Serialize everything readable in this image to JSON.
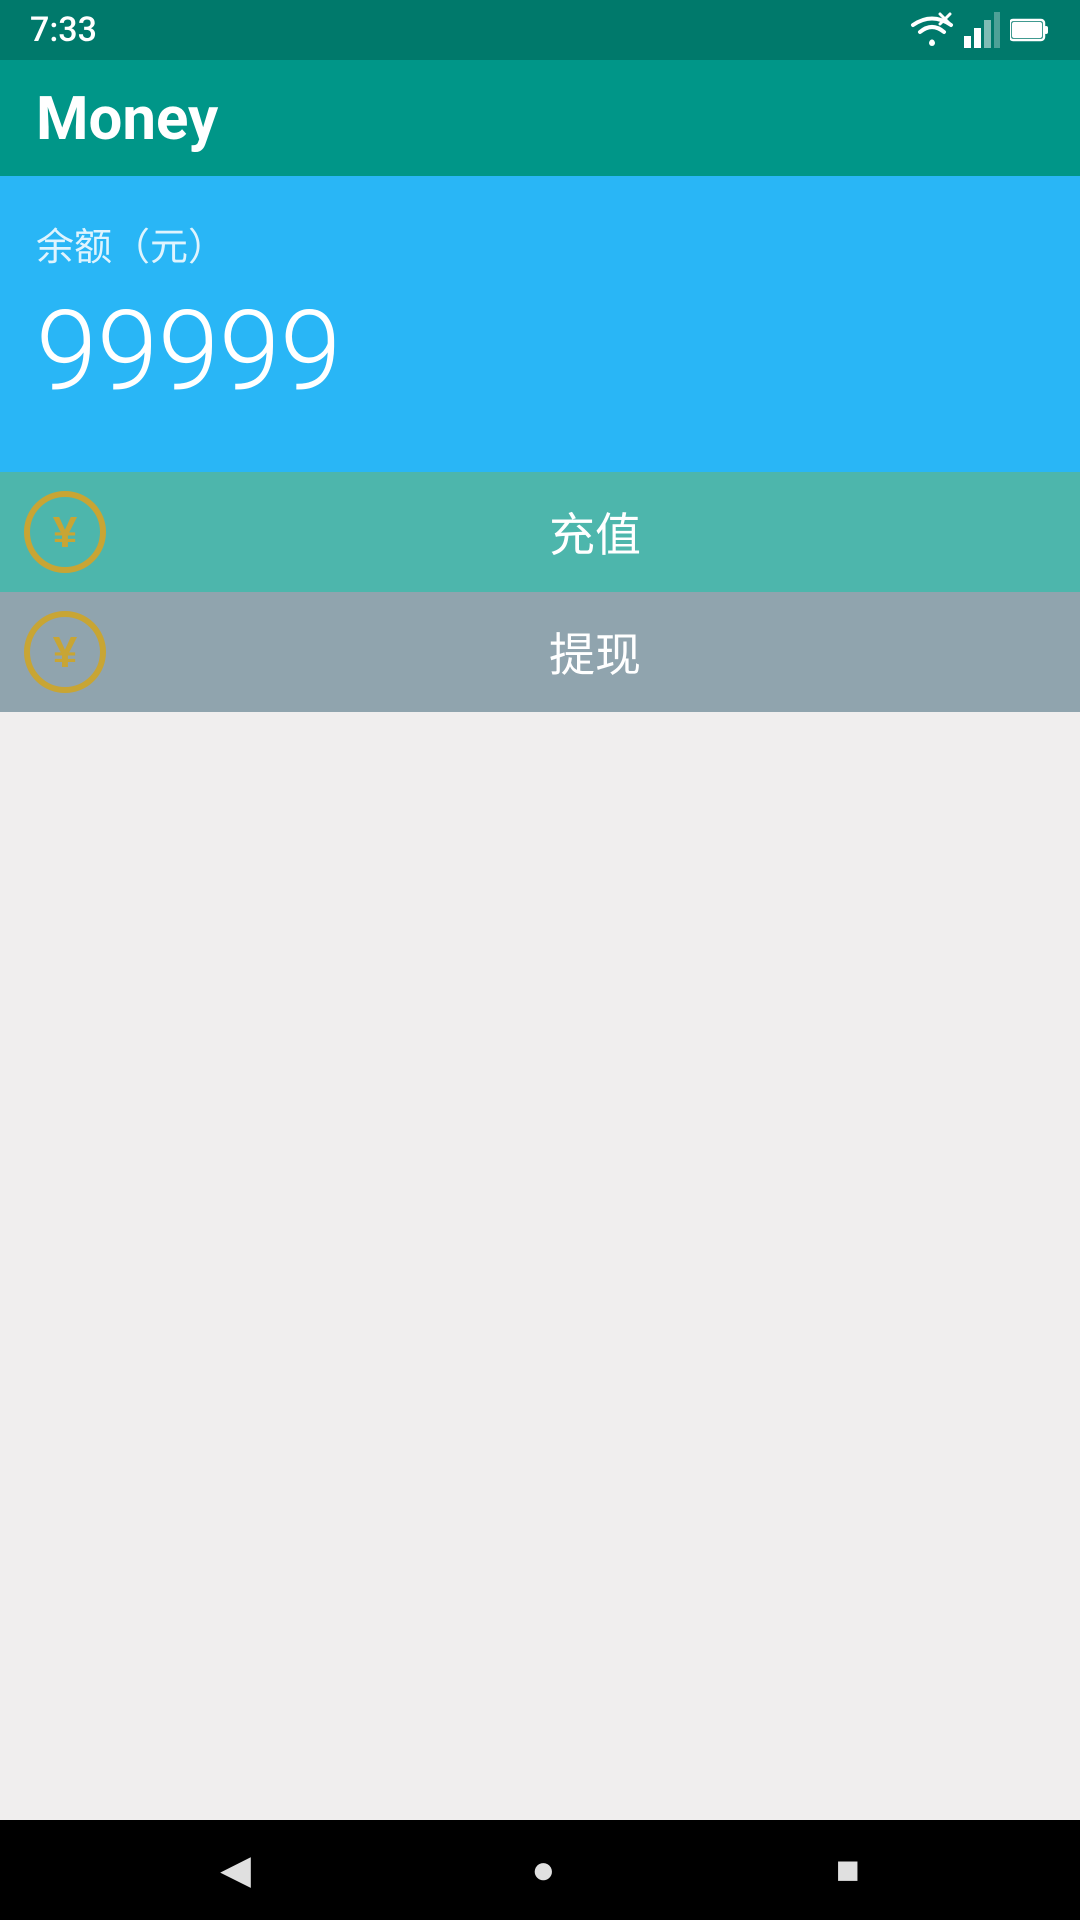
{
  "statusBar": {
    "time": "7:33",
    "icons": {
      "wifi": "📶",
      "signal": "📶",
      "battery": "🔋"
    }
  },
  "appBar": {
    "title": "Money"
  },
  "balance": {
    "label": "余额（元）",
    "amount": "99999"
  },
  "actions": {
    "recharge": {
      "label": "充值",
      "iconName": "yen-coin-icon"
    },
    "withdraw": {
      "label": "提现",
      "iconName": "yen-coin-icon"
    }
  },
  "navBar": {
    "back": "◀",
    "home": "●",
    "recent": "■"
  },
  "colors": {
    "statusBar": "#00796b",
    "appBar": "#009688",
    "balance": "#29b6f6",
    "recharge": "#4db6ac",
    "withdraw": "#90a4ae",
    "navBar": "#000000",
    "background": "#f0eeee",
    "coinColor": "#c8a534"
  }
}
